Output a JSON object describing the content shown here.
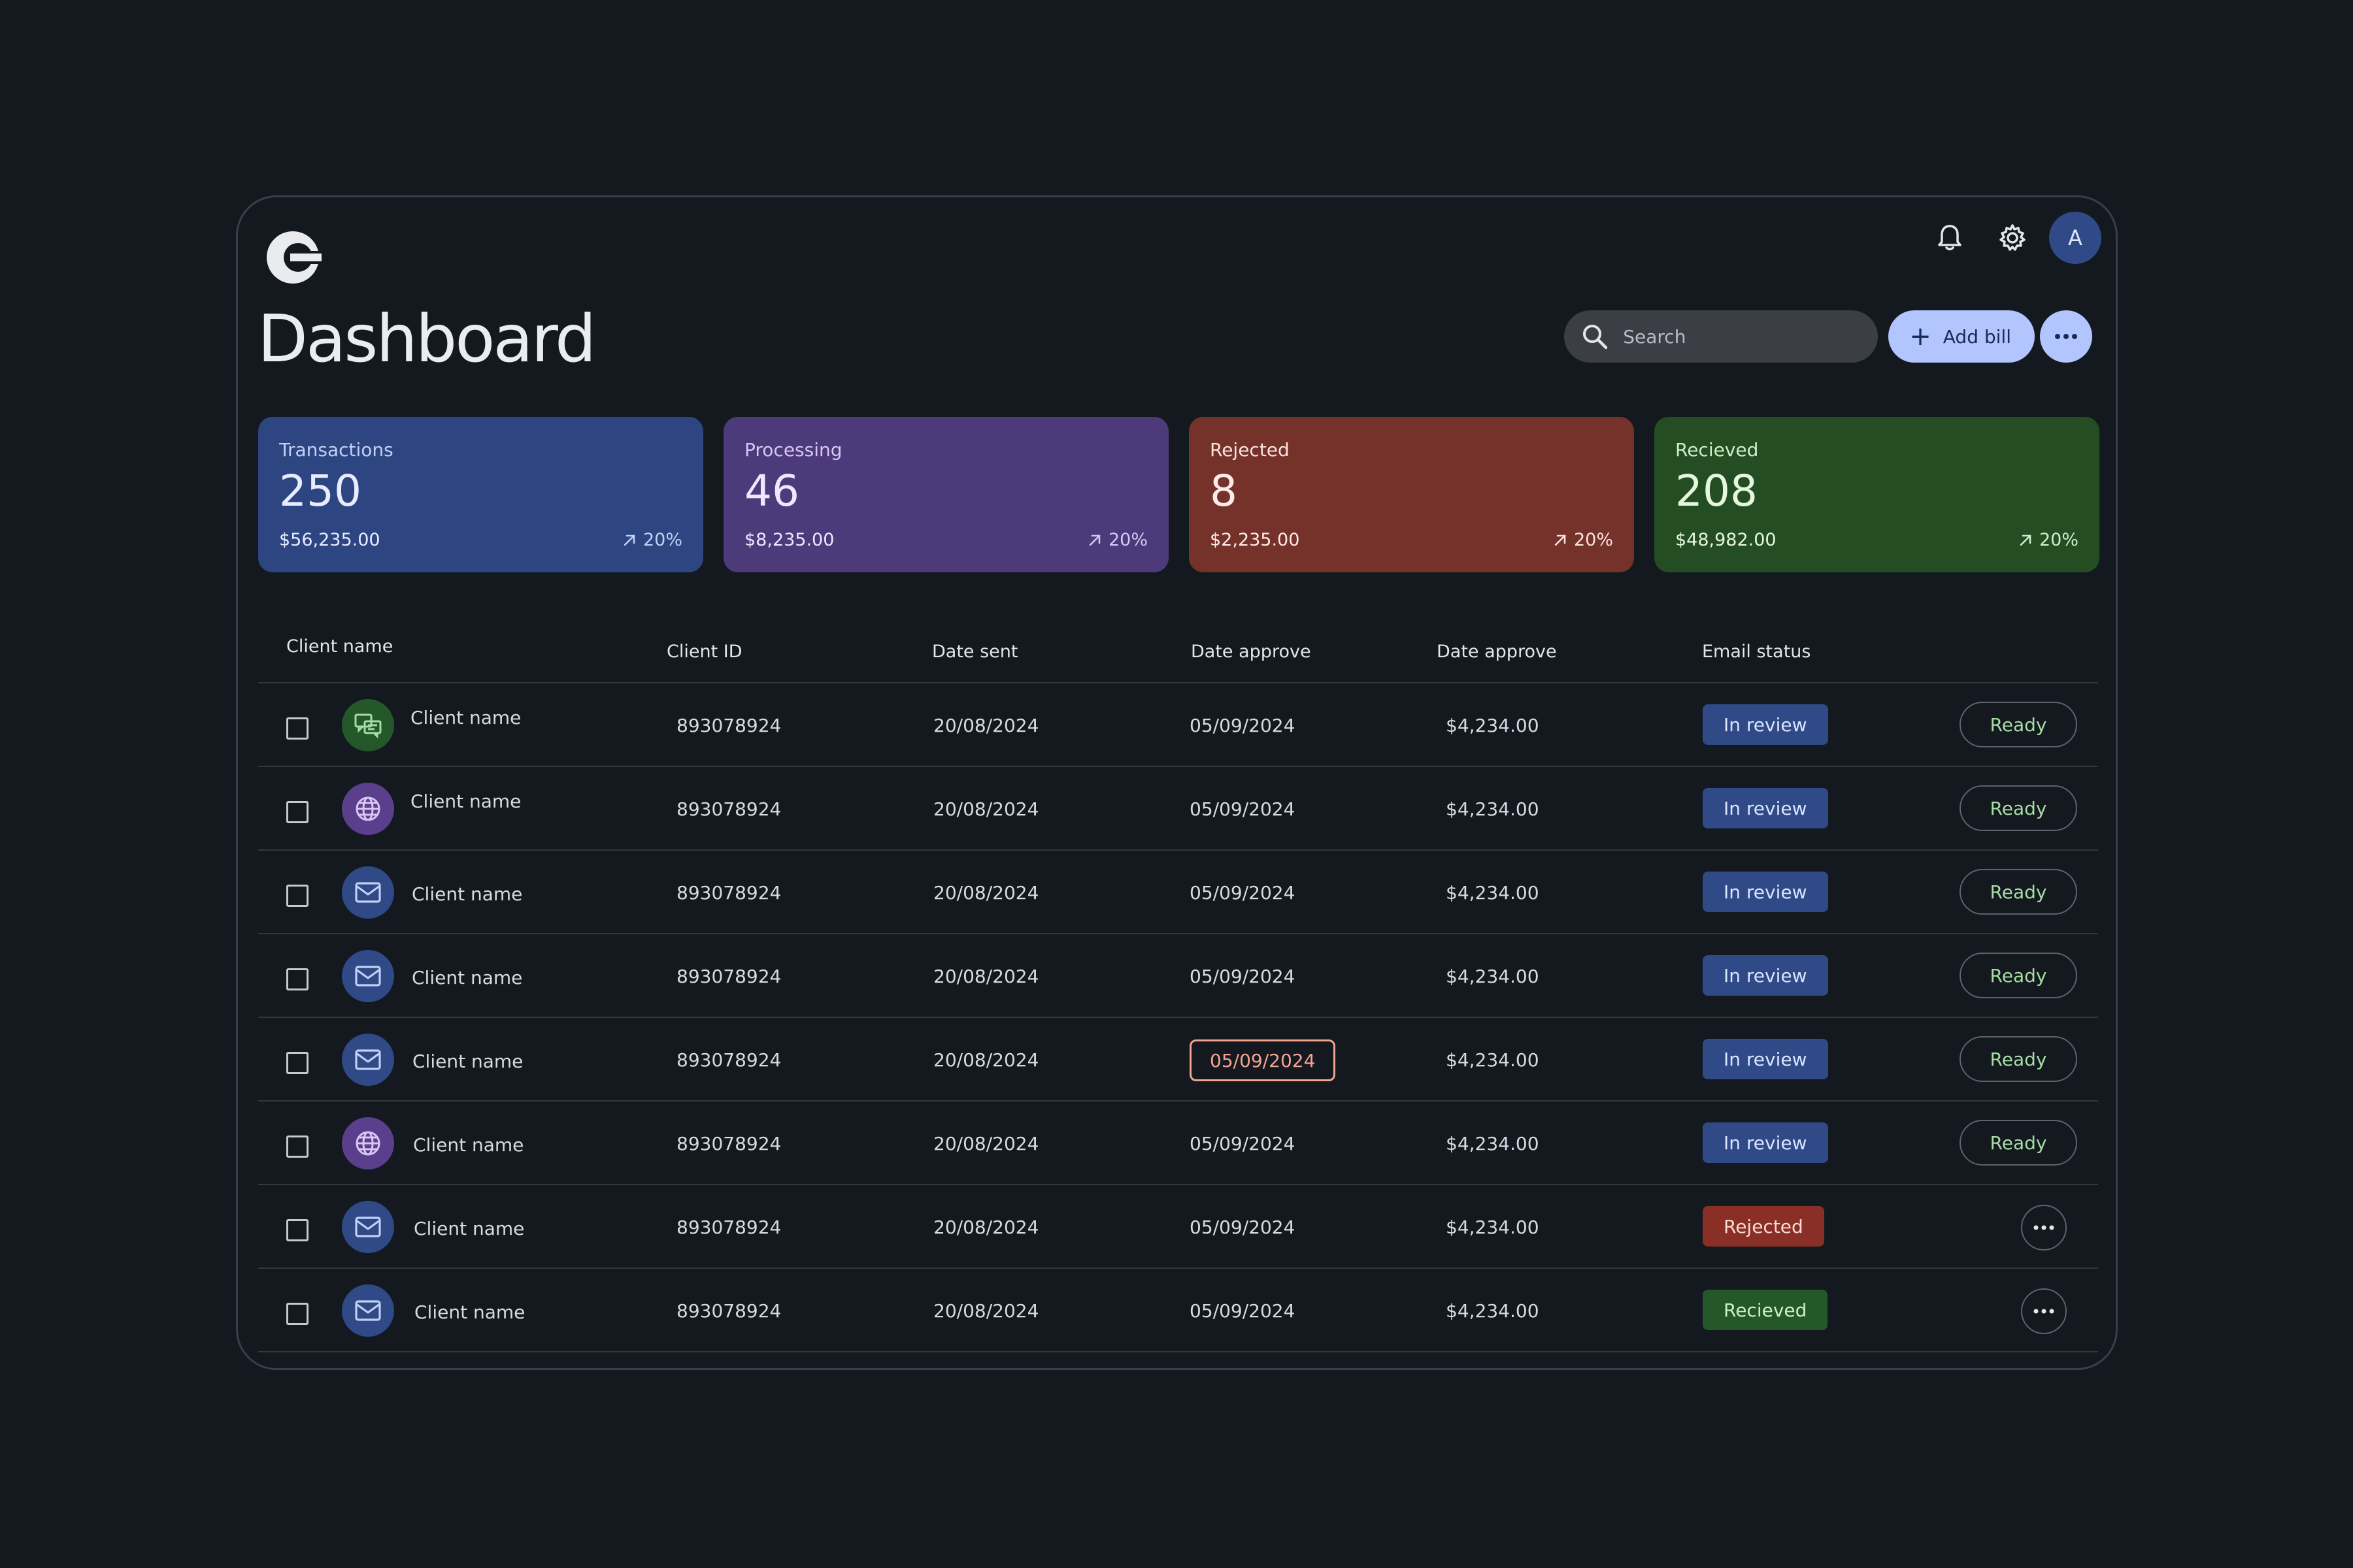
{
  "header": {
    "title": "Dashboard",
    "avatar_initial": "A",
    "search_placeholder": "Search",
    "add_bill_label": "Add bill"
  },
  "cards": [
    {
      "label": "Transactions",
      "count": "250",
      "amount": "$56,235.00",
      "change": "20%",
      "bg": "#2d4581",
      "label_color": "#c3d0f5",
      "text_color": "#e7ecff",
      "change_color": "#c3d0f5"
    },
    {
      "label": "Processing",
      "count": "46",
      "amount": "$8,235.00",
      "change": "20%",
      "bg": "#4d3a7a",
      "label_color": "#d6c7f4",
      "text_color": "#efe7ff",
      "change_color": "#d6c7f4"
    },
    {
      "label": "Rejected",
      "count": "8",
      "amount": "$2,235.00",
      "change": "20%",
      "bg": "#74322b",
      "label_color": "#fbe2dd",
      "text_color": "#ffece8",
      "change_color": "#fbe2dd"
    },
    {
      "label": "Recieved",
      "count": "208",
      "amount": "$48,982.00",
      "change": "20%",
      "bg": "#244d24",
      "label_color": "#cdeec9",
      "text_color": "#e4f7df",
      "change_color": "#cdeec9"
    }
  ],
  "table": {
    "headers": [
      "Client name",
      "Client ID",
      "Date sent",
      "Date approve",
      "Date approve",
      "Email status"
    ],
    "rows": [
      {
        "icon": "chat-icon",
        "icon_bg": "#24572a",
        "name": "Client name",
        "id": "893078924",
        "date_sent": "20/08/2024",
        "date_approve": "05/09/2024",
        "amount": "$4,234.00",
        "status": "In review",
        "status_type": "review",
        "action": "Ready"
      },
      {
        "icon": "globe-icon",
        "icon_bg": "#5a3f8c",
        "name": "Client name",
        "id": "893078924",
        "date_sent": "20/08/2024",
        "date_approve": "05/09/2024",
        "amount": "$4,234.00",
        "status": "In review",
        "status_type": "review",
        "action": "Ready"
      },
      {
        "icon": "mail-icon",
        "icon_bg": "#2f4a86",
        "name": "Client name",
        "id": "893078924",
        "date_sent": "20/08/2024",
        "date_approve": "05/09/2024",
        "amount": "$4,234.00",
        "status": "In review",
        "status_type": "review",
        "action": "Ready"
      },
      {
        "icon": "mail-icon",
        "icon_bg": "#2f4a86",
        "name": "Client name",
        "id": "893078924",
        "date_sent": "20/08/2024",
        "date_approve": "05/09/2024",
        "amount": "$4,234.00",
        "status": "In review",
        "status_type": "review",
        "action": "Ready"
      },
      {
        "icon": "mail-icon",
        "icon_bg": "#2f4a86",
        "name": "Client name",
        "id": "893078924",
        "date_sent": "20/08/2024",
        "date_approve": "05/09/2024",
        "amount": "$4,234.00",
        "status": "In review",
        "status_type": "review",
        "action": "Ready",
        "date_highlight": true
      },
      {
        "icon": "globe-icon",
        "icon_bg": "#5a3f8c",
        "name": "Client name",
        "id": "893078924",
        "date_sent": "20/08/2024",
        "date_approve": "05/09/2024",
        "amount": "$4,234.00",
        "status": "In review",
        "status_type": "review",
        "action": "Ready"
      },
      {
        "icon": "mail-icon",
        "icon_bg": "#2f4a86",
        "name": "Client name",
        "id": "893078924",
        "date_sent": "20/08/2024",
        "date_approve": "05/09/2024",
        "amount": "$4,234.00",
        "status": "Rejected",
        "status_type": "rejected",
        "action": "more"
      },
      {
        "icon": "mail-icon",
        "icon_bg": "#2f4a86",
        "name": "Client name",
        "id": "893078924",
        "date_sent": "20/08/2024",
        "date_approve": "05/09/2024",
        "amount": "$4,234.00",
        "status": "Recieved",
        "status_type": "received",
        "action": "more"
      }
    ]
  }
}
